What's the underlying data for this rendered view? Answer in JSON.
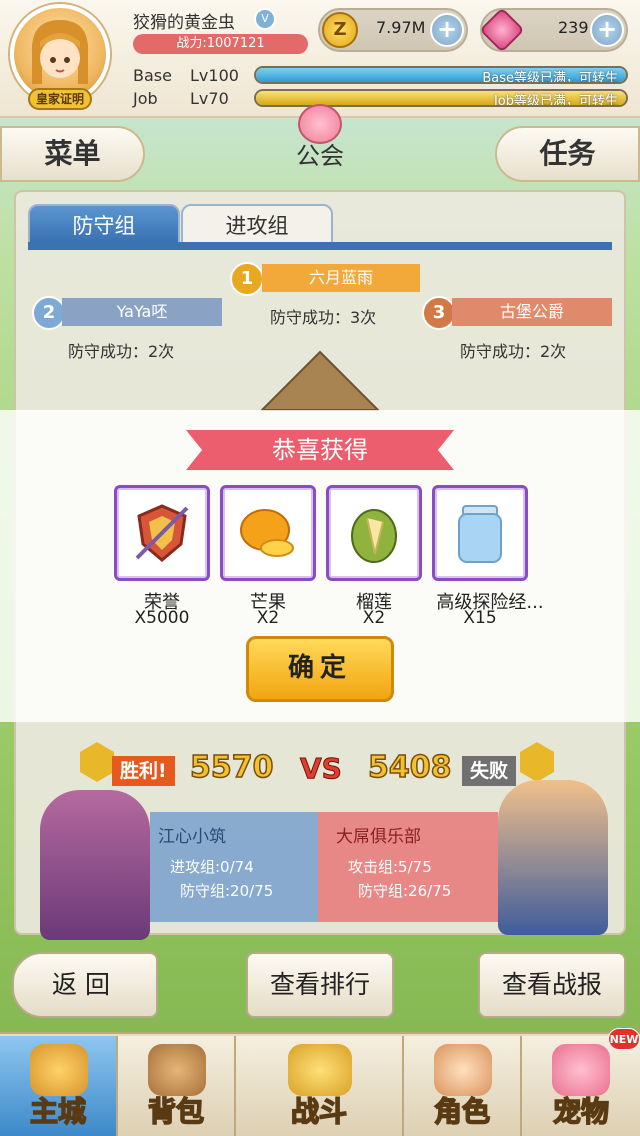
{
  "player": {
    "name": "狡猾的黄金虫",
    "power": "战力:1007121",
    "royal_badge": "皇家证明",
    "zeny": "7.97M",
    "gems": "239",
    "base_label": "Base",
    "base_level": "Lv100",
    "base_note": "Base等级已满，可转生",
    "job_label": "Job",
    "job_level": "Lv70",
    "job_note": "Job等级已满，可转生"
  },
  "nav": {
    "menu": "菜单",
    "title": "公会",
    "tasks": "任务"
  },
  "tabs": {
    "defense": "防守组",
    "attack": "进攻组"
  },
  "ranking": {
    "first": {
      "rank": "1",
      "name": "六月蓝雨",
      "result": "防守成功：3次"
    },
    "second": {
      "rank": "2",
      "name": "YaYa呸",
      "result": "防守成功：2次"
    },
    "third": {
      "rank": "3",
      "name": "古堡公爵",
      "result": "防守成功：2次"
    }
  },
  "reward": {
    "title": "恭喜获得",
    "items": [
      {
        "name": "荣誉",
        "qty": "X5000",
        "icon": "honor-shield-icon"
      },
      {
        "name": "芒果",
        "qty": "X2",
        "icon": "mango-icon"
      },
      {
        "name": "榴莲",
        "qty": "X2",
        "icon": "durian-icon"
      },
      {
        "name": "高级探险经...",
        "qty": "X15",
        "icon": "exp-jar-icon"
      }
    ],
    "confirm": "确定"
  },
  "battle": {
    "win_tag": "胜利!",
    "lose_tag": "失败",
    "left_score": "5570",
    "vs": "VS",
    "right_score": "5408",
    "left_guild": {
      "name": "江心小筑",
      "attack": "进攻组:0/74",
      "defense": "防守组:20/75"
    },
    "right_guild": {
      "name": "大屌俱乐部",
      "attack": "攻击组:5/75",
      "defense": "防守组:26/75"
    }
  },
  "buttons": {
    "back": "返回",
    "ranking": "查看排行",
    "report": "查看战报"
  },
  "dock": {
    "items": [
      "主城",
      "背包",
      "战斗",
      "角色",
      "宠物"
    ],
    "new_badge": "NEW"
  },
  "colors": {
    "accent_blue": "#3a72b2",
    "ribbon_red": "#ec5d6e",
    "item_border": "#8a4cc0",
    "confirm_yellow": "#f2a510"
  }
}
